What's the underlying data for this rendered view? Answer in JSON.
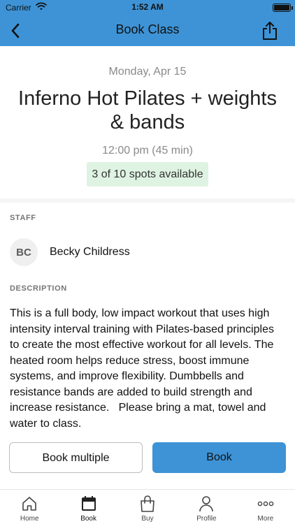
{
  "status_bar": {
    "carrier": "Carrier",
    "time": "1:52 AM"
  },
  "nav": {
    "title": "Book Class",
    "back_icon": "chevron-left-icon",
    "share_icon": "share-icon"
  },
  "class_info": {
    "date": "Monday, Apr 15",
    "name": "Inferno Hot Pilates + weights & bands",
    "time": "12:00 pm (45 min)",
    "spots": "3 of 10 spots available"
  },
  "staff": {
    "label": "STAFF",
    "initials": "BC",
    "name": "Becky Childress"
  },
  "description": {
    "label": "DESCRIPTION",
    "text": "This is a full body, low impact workout that uses high intensity interval training with Pilates-based principles to create the most effective workout for all levels. The heated room helps reduce stress, boost immune systems, and improve flexibility. Dumbbells and resistance bands are added to build strength and increase resistance.   Please bring a mat, towel and water to class."
  },
  "actions": {
    "book_multiple": "Book multiple",
    "book": "Book"
  },
  "tabs": [
    {
      "label": "Home",
      "icon": "home-icon"
    },
    {
      "label": "Book",
      "icon": "calendar-icon"
    },
    {
      "label": "Buy",
      "icon": "shopping-bag-icon"
    },
    {
      "label": "Profile",
      "icon": "person-icon"
    },
    {
      "label": "More",
      "icon": "more-dots-icon"
    }
  ],
  "colors": {
    "primary": "#3d93d6",
    "spots_badge": "#dff3e2",
    "muted_text": "#8a8a8a"
  }
}
